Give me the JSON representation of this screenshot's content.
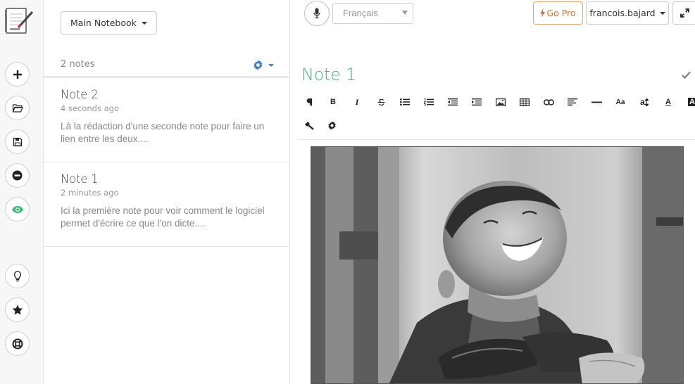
{
  "rail": {
    "icons": [
      "notebook-logo",
      "plus-icon",
      "folder-open-icon",
      "save-icon",
      "minus-circle-icon",
      "eye-icon",
      "lightbulb-icon",
      "star-icon",
      "lifebuoy-icon"
    ],
    "accent": "#3cb878"
  },
  "list": {
    "notebook_label": "Main Notebook",
    "count_label": "2 notes",
    "gear_color": "#3f7fc1",
    "notes": [
      {
        "title": "Note 2",
        "time": "4 seconds ago",
        "snippet": "Là la rédaction d'une seconde note pour faire un lien entre les deux...."
      },
      {
        "title": "Note 1",
        "time": "2 minutes ago",
        "snippet": "Ici la première note pour voir comment le logiciel permet d'écrire ce que l'on dicte...."
      }
    ]
  },
  "editor": {
    "language": "Français",
    "go_pro_label": "Go Pro",
    "go_pro_color": "#c9763a",
    "user_label": "francois.bajard",
    "note_title": "Note 1",
    "title_color": "#3cb878",
    "toolbar": [
      "pilcrow-icon",
      "bold-icon",
      "italic-icon",
      "strikethrough-icon",
      "bullet-list-icon",
      "numbered-list-icon",
      "outdent-icon",
      "indent-icon",
      "image-icon",
      "table-icon",
      "link-icon",
      "align-left-icon",
      "horizontal-rule-icon",
      "font-size-icon",
      "line-height-icon",
      "font-color-icon",
      "highlight-icon"
    ],
    "toolbar_labels": {
      "bold": "B",
      "italic": "I",
      "font_size": "Aa",
      "line_height": "a",
      "font_color": "A",
      "highlight": "A"
    },
    "toolbar2": [
      "hammer-icon",
      "settings-icon"
    ]
  }
}
